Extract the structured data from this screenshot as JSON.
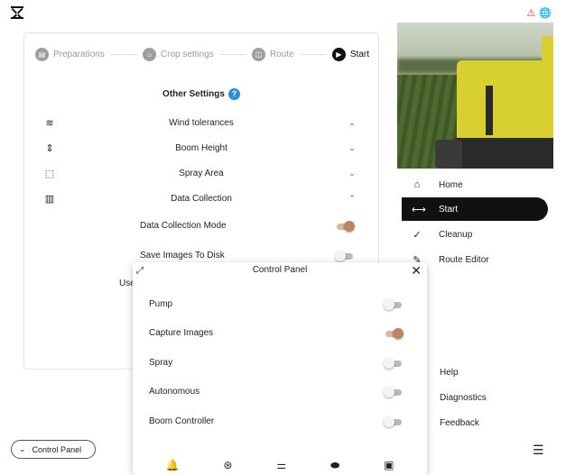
{
  "stepper": {
    "steps": [
      {
        "label": "Preparations",
        "icon": "clipboard-icon",
        "active": false
      },
      {
        "label": "Crop settings",
        "icon": "crop-icon",
        "active": false
      },
      {
        "label": "Route",
        "icon": "route-icon",
        "active": false
      },
      {
        "label": "Start",
        "icon": "play-icon",
        "active": true
      }
    ]
  },
  "other_settings": {
    "title": "Other Settings",
    "help_icon": "?",
    "rows": [
      {
        "label": "Wind tolerances",
        "icon": "wind-icon",
        "glyph": "≋",
        "expanded": false
      },
      {
        "label": "Boom Height",
        "icon": "boom-height-icon",
        "glyph": "⇕",
        "expanded": false
      },
      {
        "label": "Spray Area",
        "icon": "spray-area-icon",
        "glyph": "⬚",
        "expanded": false
      },
      {
        "label": "Data Collection",
        "icon": "data-collection-icon",
        "glyph": "▥",
        "expanded": true
      }
    ],
    "data_collection": {
      "mode_label": "Data Collection Mode",
      "mode_on": true,
      "save_images_label": "Save Images To Disk",
      "save_images_on": false,
      "clipped_label": "Use"
    }
  },
  "control_panel": {
    "title": "Control Panel",
    "close_glyph": "✕",
    "expand_glyph": "⤢",
    "rows": [
      {
        "label": "Pump",
        "on": false
      },
      {
        "label": "Capture Images",
        "on": true
      },
      {
        "label": "Spray",
        "on": false
      },
      {
        "label": "Autonomous",
        "on": false
      },
      {
        "label": "Boom Controller",
        "on": false
      }
    ],
    "bottom_icons": [
      {
        "name": "bell-icon",
        "glyph": "🔔"
      },
      {
        "name": "steering-wheel-icon",
        "glyph": "⊛"
      },
      {
        "name": "sliders-icon",
        "glyph": "⚌"
      },
      {
        "name": "toggle-icon",
        "glyph": "⬬"
      },
      {
        "name": "image-icon",
        "glyph": "▣"
      }
    ]
  },
  "control_panel_chip": {
    "label": "Control Panel",
    "glyph": "⌄"
  },
  "nav": {
    "items": [
      {
        "label": "Home",
        "icon": "home-icon",
        "glyph": "⌂",
        "active": false
      },
      {
        "label": "Start",
        "icon": "arrows-icon",
        "glyph": "⟷",
        "active": true
      },
      {
        "label": "Cleanup",
        "icon": "broom-icon",
        "glyph": "✓",
        "active": false
      },
      {
        "label": "Route Editor",
        "icon": "pencil-icon",
        "glyph": "✎",
        "active": false
      }
    ],
    "footer": [
      "Help",
      "Diagnostics",
      "Feedback"
    ]
  },
  "colors": {
    "accent": "#2b8be0",
    "toggle_on": "#b98764",
    "active_nav": "#111111"
  }
}
